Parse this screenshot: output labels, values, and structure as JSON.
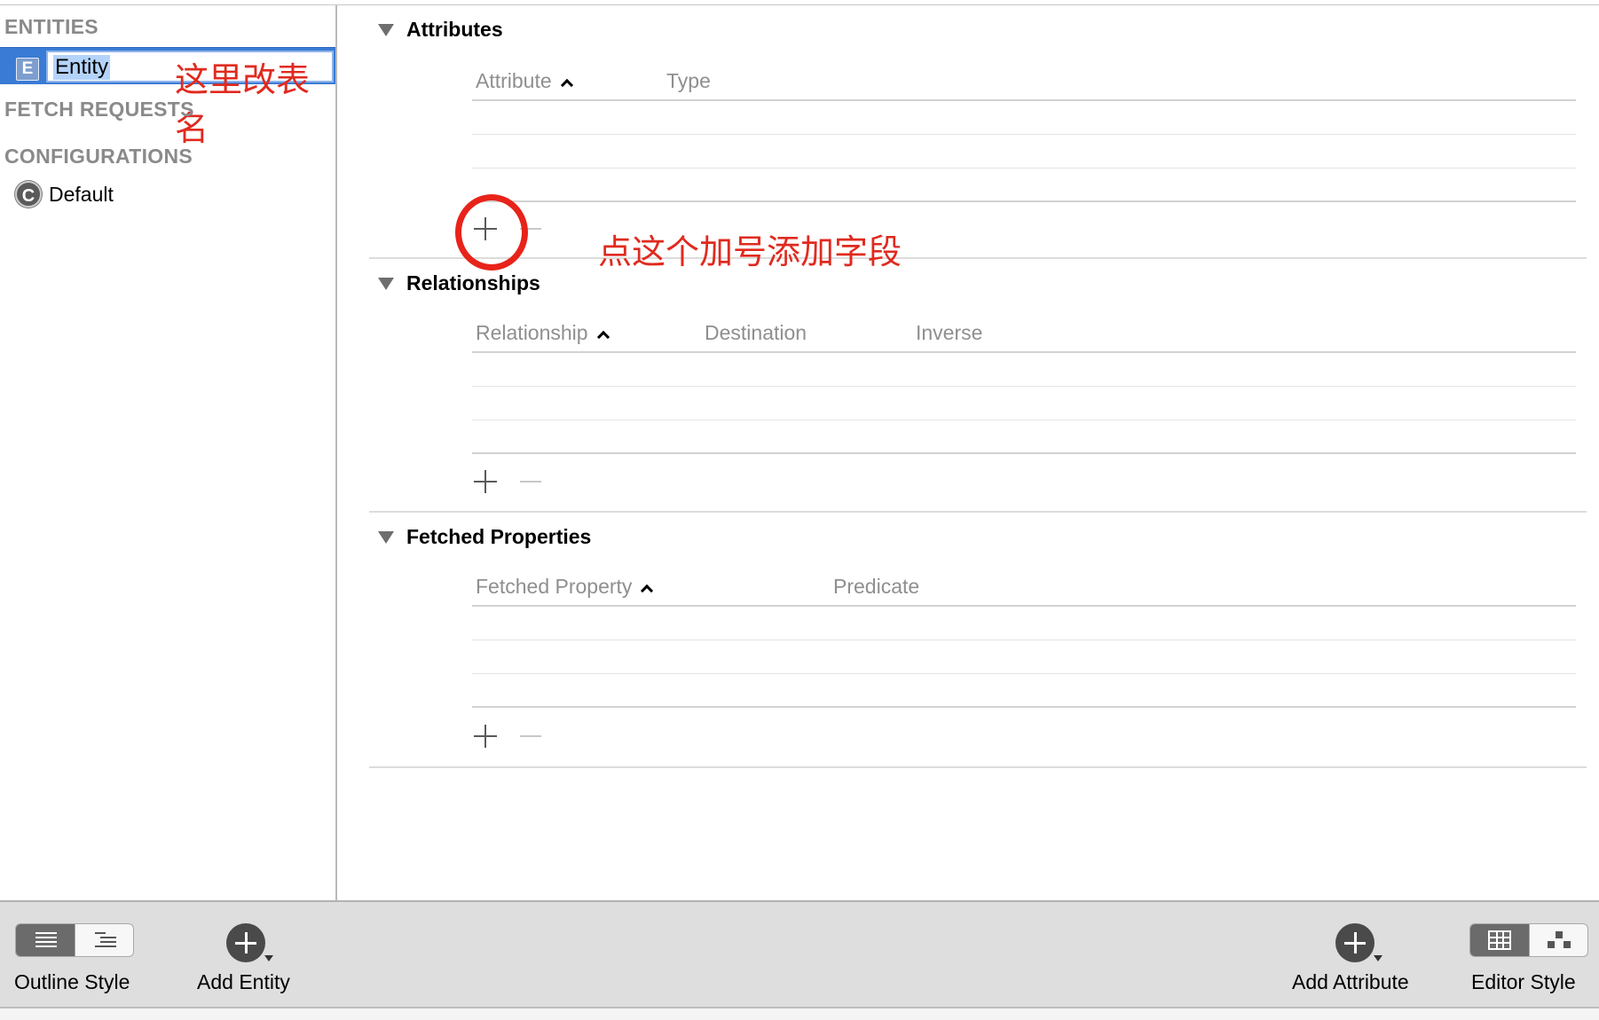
{
  "sidebar": {
    "entities_header": "ENTITIES",
    "entity": {
      "badge": "E",
      "name": "Entity"
    },
    "rename_annotation": "这里改表名",
    "fetch_requests_header": "FETCH REQUESTS",
    "configurations_header": "CONFIGURATIONS",
    "configuration": {
      "badge": "C",
      "name": "Default"
    }
  },
  "main": {
    "attributes": {
      "title": "Attributes",
      "columns": [
        "Attribute",
        "Type"
      ],
      "add_annotation": "点这个加号添加字段"
    },
    "relationships": {
      "title": "Relationships",
      "columns": [
        "Relationship",
        "Destination",
        "Inverse"
      ]
    },
    "fetched_properties": {
      "title": "Fetched Properties",
      "columns": [
        "Fetched Property",
        "Predicate"
      ]
    }
  },
  "toolbar": {
    "outline_style": "Outline Style",
    "add_entity": "Add Entity",
    "add_attribute": "Add Attribute",
    "editor_style": "Editor Style"
  },
  "colors": {
    "selection": "#3a7bd5",
    "annotation": "#e02a1f",
    "toolbar": "#dedede"
  }
}
